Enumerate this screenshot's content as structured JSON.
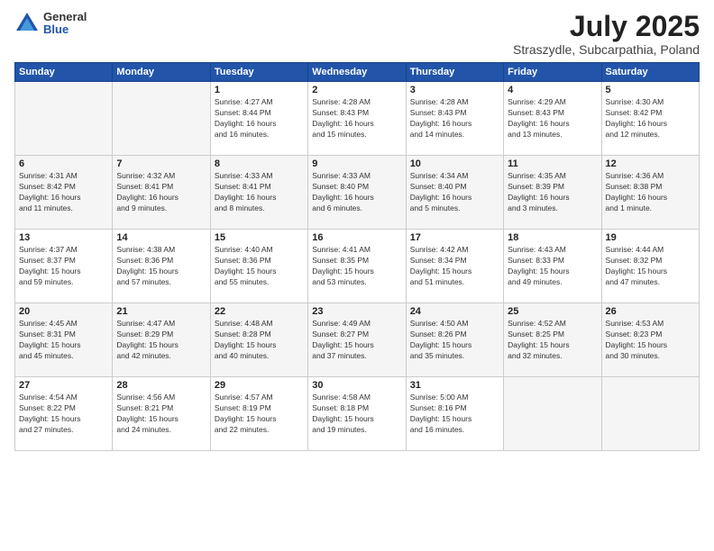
{
  "logo": {
    "general": "General",
    "blue": "Blue"
  },
  "title": "July 2025",
  "subtitle": "Straszydle, Subcarpathia, Poland",
  "days_header": [
    "Sunday",
    "Monday",
    "Tuesday",
    "Wednesday",
    "Thursday",
    "Friday",
    "Saturday"
  ],
  "weeks": [
    [
      {
        "day": "",
        "info": ""
      },
      {
        "day": "",
        "info": ""
      },
      {
        "day": "1",
        "info": "Sunrise: 4:27 AM\nSunset: 8:44 PM\nDaylight: 16 hours\nand 16 minutes."
      },
      {
        "day": "2",
        "info": "Sunrise: 4:28 AM\nSunset: 8:43 PM\nDaylight: 16 hours\nand 15 minutes."
      },
      {
        "day": "3",
        "info": "Sunrise: 4:28 AM\nSunset: 8:43 PM\nDaylight: 16 hours\nand 14 minutes."
      },
      {
        "day": "4",
        "info": "Sunrise: 4:29 AM\nSunset: 8:43 PM\nDaylight: 16 hours\nand 13 minutes."
      },
      {
        "day": "5",
        "info": "Sunrise: 4:30 AM\nSunset: 8:42 PM\nDaylight: 16 hours\nand 12 minutes."
      }
    ],
    [
      {
        "day": "6",
        "info": "Sunrise: 4:31 AM\nSunset: 8:42 PM\nDaylight: 16 hours\nand 11 minutes."
      },
      {
        "day": "7",
        "info": "Sunrise: 4:32 AM\nSunset: 8:41 PM\nDaylight: 16 hours\nand 9 minutes."
      },
      {
        "day": "8",
        "info": "Sunrise: 4:33 AM\nSunset: 8:41 PM\nDaylight: 16 hours\nand 8 minutes."
      },
      {
        "day": "9",
        "info": "Sunrise: 4:33 AM\nSunset: 8:40 PM\nDaylight: 16 hours\nand 6 minutes."
      },
      {
        "day": "10",
        "info": "Sunrise: 4:34 AM\nSunset: 8:40 PM\nDaylight: 16 hours\nand 5 minutes."
      },
      {
        "day": "11",
        "info": "Sunrise: 4:35 AM\nSunset: 8:39 PM\nDaylight: 16 hours\nand 3 minutes."
      },
      {
        "day": "12",
        "info": "Sunrise: 4:36 AM\nSunset: 8:38 PM\nDaylight: 16 hours\nand 1 minute."
      }
    ],
    [
      {
        "day": "13",
        "info": "Sunrise: 4:37 AM\nSunset: 8:37 PM\nDaylight: 15 hours\nand 59 minutes."
      },
      {
        "day": "14",
        "info": "Sunrise: 4:38 AM\nSunset: 8:36 PM\nDaylight: 15 hours\nand 57 minutes."
      },
      {
        "day": "15",
        "info": "Sunrise: 4:40 AM\nSunset: 8:36 PM\nDaylight: 15 hours\nand 55 minutes."
      },
      {
        "day": "16",
        "info": "Sunrise: 4:41 AM\nSunset: 8:35 PM\nDaylight: 15 hours\nand 53 minutes."
      },
      {
        "day": "17",
        "info": "Sunrise: 4:42 AM\nSunset: 8:34 PM\nDaylight: 15 hours\nand 51 minutes."
      },
      {
        "day": "18",
        "info": "Sunrise: 4:43 AM\nSunset: 8:33 PM\nDaylight: 15 hours\nand 49 minutes."
      },
      {
        "day": "19",
        "info": "Sunrise: 4:44 AM\nSunset: 8:32 PM\nDaylight: 15 hours\nand 47 minutes."
      }
    ],
    [
      {
        "day": "20",
        "info": "Sunrise: 4:45 AM\nSunset: 8:31 PM\nDaylight: 15 hours\nand 45 minutes."
      },
      {
        "day": "21",
        "info": "Sunrise: 4:47 AM\nSunset: 8:29 PM\nDaylight: 15 hours\nand 42 minutes."
      },
      {
        "day": "22",
        "info": "Sunrise: 4:48 AM\nSunset: 8:28 PM\nDaylight: 15 hours\nand 40 minutes."
      },
      {
        "day": "23",
        "info": "Sunrise: 4:49 AM\nSunset: 8:27 PM\nDaylight: 15 hours\nand 37 minutes."
      },
      {
        "day": "24",
        "info": "Sunrise: 4:50 AM\nSunset: 8:26 PM\nDaylight: 15 hours\nand 35 minutes."
      },
      {
        "day": "25",
        "info": "Sunrise: 4:52 AM\nSunset: 8:25 PM\nDaylight: 15 hours\nand 32 minutes."
      },
      {
        "day": "26",
        "info": "Sunrise: 4:53 AM\nSunset: 8:23 PM\nDaylight: 15 hours\nand 30 minutes."
      }
    ],
    [
      {
        "day": "27",
        "info": "Sunrise: 4:54 AM\nSunset: 8:22 PM\nDaylight: 15 hours\nand 27 minutes."
      },
      {
        "day": "28",
        "info": "Sunrise: 4:56 AM\nSunset: 8:21 PM\nDaylight: 15 hours\nand 24 minutes."
      },
      {
        "day": "29",
        "info": "Sunrise: 4:57 AM\nSunset: 8:19 PM\nDaylight: 15 hours\nand 22 minutes."
      },
      {
        "day": "30",
        "info": "Sunrise: 4:58 AM\nSunset: 8:18 PM\nDaylight: 15 hours\nand 19 minutes."
      },
      {
        "day": "31",
        "info": "Sunrise: 5:00 AM\nSunset: 8:16 PM\nDaylight: 15 hours\nand 16 minutes."
      },
      {
        "day": "",
        "info": ""
      },
      {
        "day": "",
        "info": ""
      }
    ]
  ]
}
